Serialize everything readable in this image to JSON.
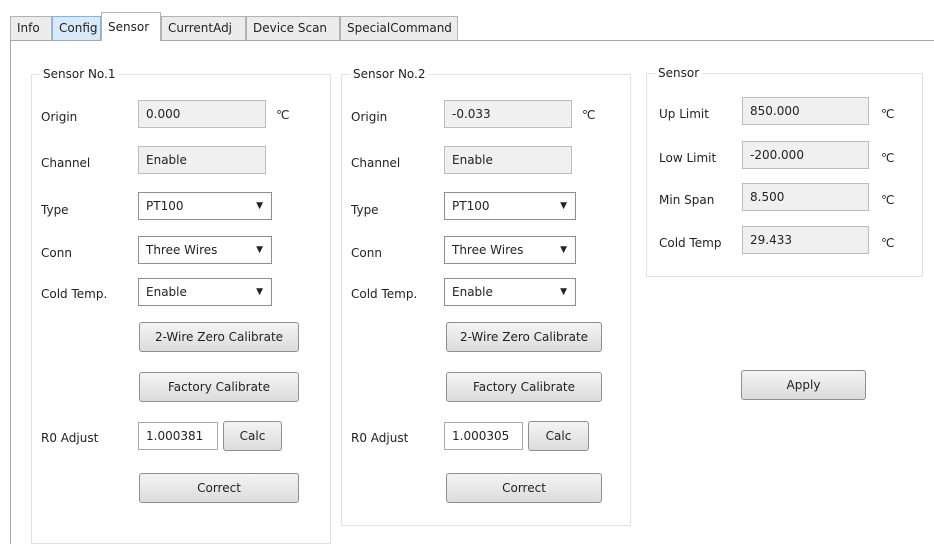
{
  "tabs": [
    {
      "label": "Info"
    },
    {
      "label": "Config"
    },
    {
      "label": "Sensor"
    },
    {
      "label": "CurrentAdj"
    },
    {
      "label": "Device Scan"
    },
    {
      "label": "SpecialCommand"
    }
  ],
  "active_tab": "Sensor",
  "sensor1": {
    "title": "Sensor No.1",
    "origin_label": "Origin",
    "origin_value": "0.000",
    "origin_unit": "℃",
    "channel_label": "Channel",
    "channel_value": "Enable",
    "type_label": "Type",
    "type_value": "PT100",
    "conn_label": "Conn",
    "conn_value": "Three Wires",
    "cold_label": "Cold Temp.",
    "cold_value": "Enable",
    "zero_btn": "2-Wire Zero Calibrate",
    "factory_btn": "Factory Calibrate",
    "r0_label": "R0 Adjust",
    "r0_value": "1.000381",
    "calc_btn": "Calc",
    "correct_btn": "Correct"
  },
  "sensor2": {
    "title": "Sensor No.2",
    "origin_label": "Origin",
    "origin_value": "-0.033",
    "origin_unit": "℃",
    "channel_label": "Channel",
    "channel_value": "Enable",
    "type_label": "Type",
    "type_value": "PT100",
    "conn_label": "Conn",
    "conn_value": "Three Wires",
    "cold_label": "Cold Temp.",
    "cold_value": "Enable",
    "zero_btn": "2-Wire Zero Calibrate",
    "factory_btn": "Factory Calibrate",
    "r0_label": "R0 Adjust",
    "r0_value": "1.000305",
    "calc_btn": "Calc",
    "correct_btn": "Correct"
  },
  "sensor": {
    "title": "Sensor",
    "up_label": "Up Limit",
    "up_value": "850.000",
    "low_label": "Low Limit",
    "low_value": "-200.000",
    "span_label": "Min Span",
    "span_value": "8.500",
    "cold_label": "Cold Temp",
    "cold_value": "29.433",
    "unit": "℃"
  },
  "apply_btn": "Apply",
  "icons": {
    "dropdown": "chevron-down-icon"
  }
}
